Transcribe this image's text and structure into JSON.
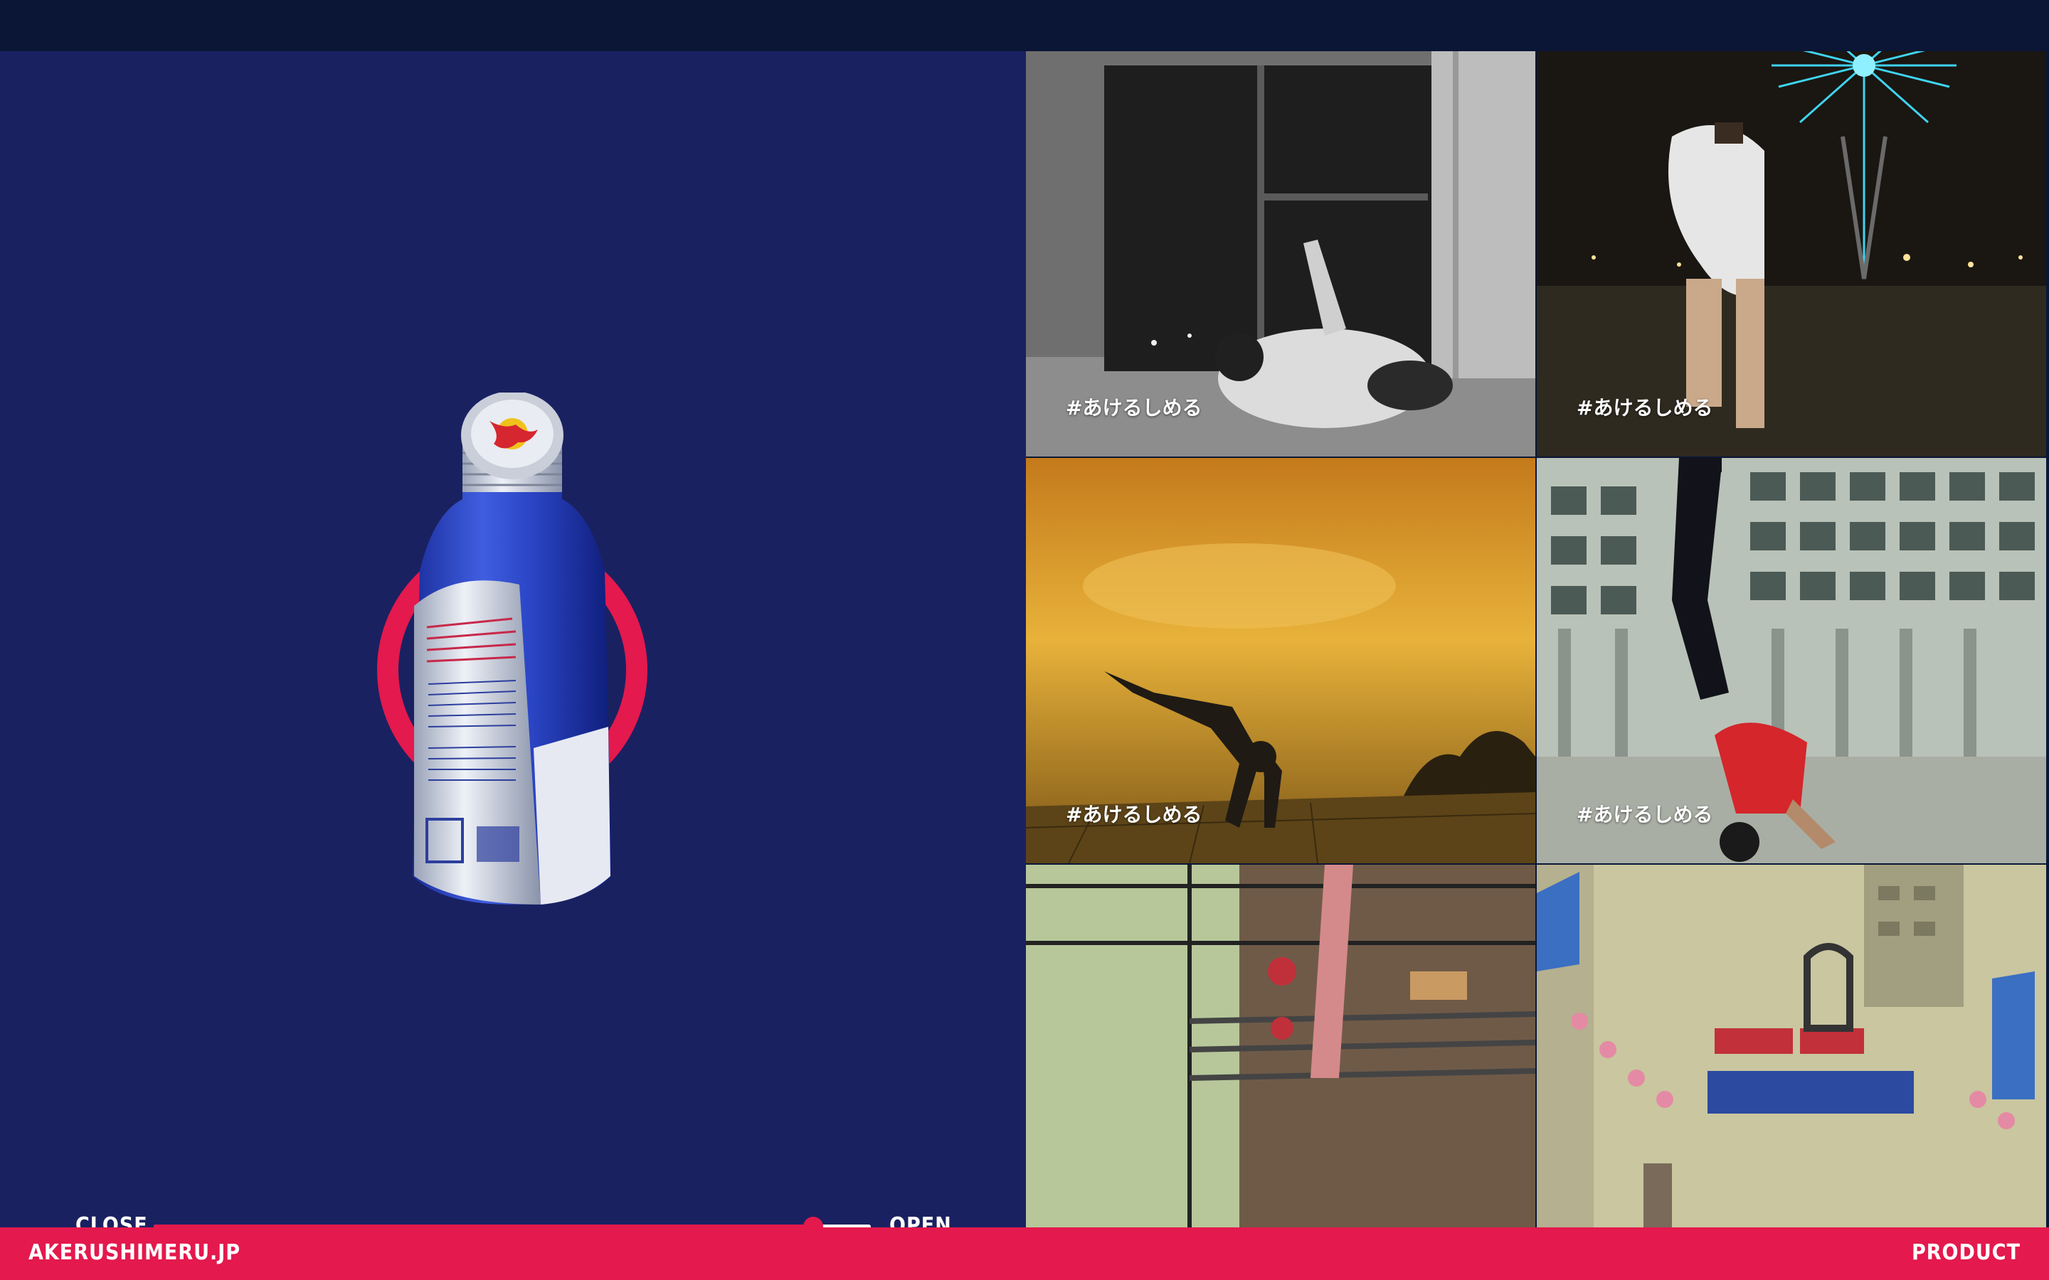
{
  "site": {
    "domain": "AKERUSHIMERU.JP",
    "nav_product": "PRODUCT"
  },
  "slider": {
    "close_label": "CLOSE",
    "open_label": "OPEN",
    "value_fraction": 0.92
  },
  "tiles": [
    {
      "hashtag": "#あけるしめる"
    },
    {
      "hashtag": "#あけるしめる"
    },
    {
      "hashtag": "#あけるしめる"
    },
    {
      "hashtag": "#あけるしめる"
    },
    {
      "hashtag": ""
    },
    {
      "hashtag": ""
    }
  ],
  "colors": {
    "accent": "#e4194d",
    "panel": "#1a2161",
    "topbar": "#0b1636"
  },
  "icons": [
    "bull-logo-icon",
    "slider-thumb-icon"
  ]
}
